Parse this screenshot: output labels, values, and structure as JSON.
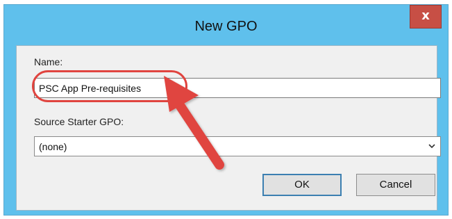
{
  "dialog": {
    "title": "New GPO",
    "close_label": "x",
    "name_label": "Name:",
    "name_value": "PSC App Pre-requisites",
    "source_label": "Source Starter GPO:",
    "source_value": "(none)",
    "ok_label": "OK",
    "cancel_label": "Cancel"
  },
  "annotations": {
    "highlight_color": "#e0443f",
    "arrow_color": "#e0443f"
  },
  "colors": {
    "titlebar": "#5fc0ec",
    "close_button": "#c74f45",
    "client_background": "#f0f0f0"
  }
}
